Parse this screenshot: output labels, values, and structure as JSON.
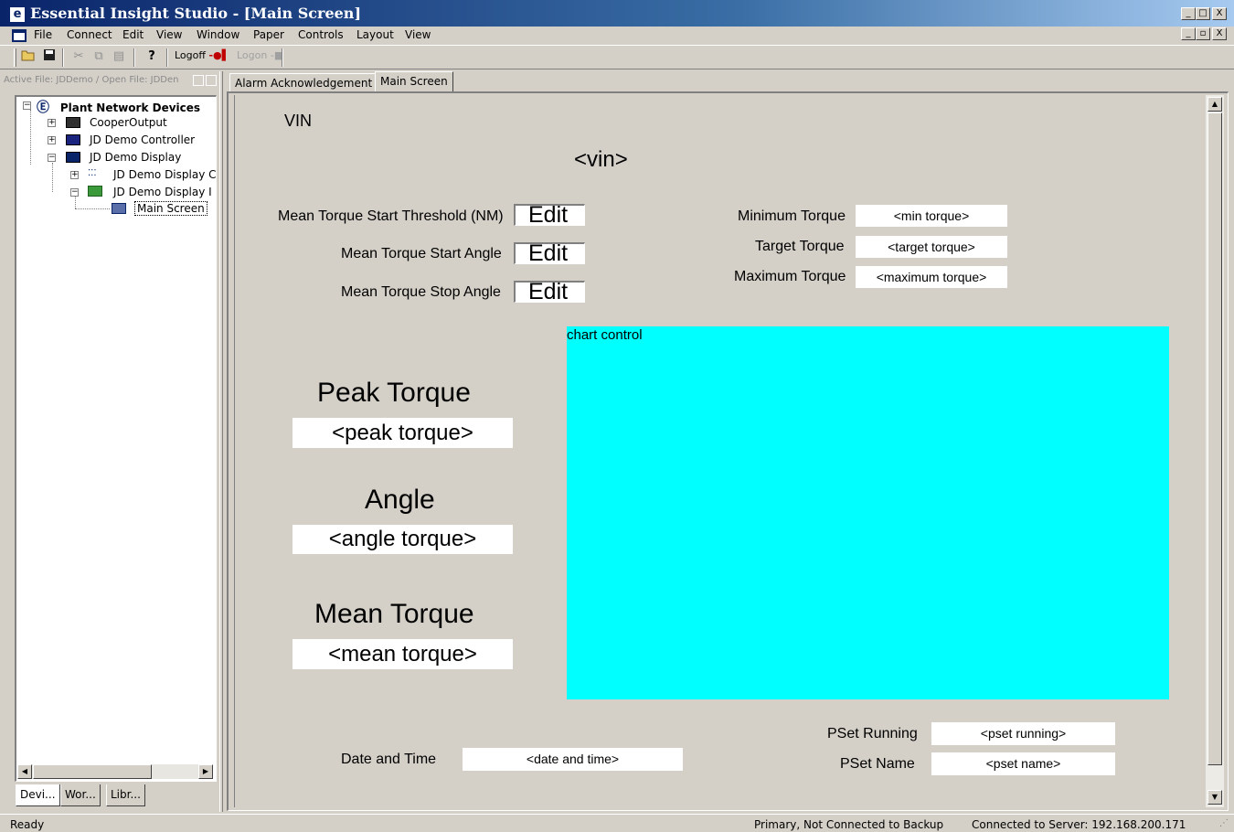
{
  "window": {
    "title": "Essential Insight Studio - [Main Screen]",
    "icon": "app-logo-icon",
    "caption_buttons": [
      "_",
      "□",
      "X"
    ],
    "mdi_buttons": [
      "_",
      "▫",
      "X"
    ]
  },
  "menu": {
    "items": [
      "File",
      "Connect",
      "Edit",
      "View",
      "Window",
      "Paper",
      "Controls",
      "Layout",
      "View"
    ]
  },
  "toolbar": {
    "logoff_label": "Logoff",
    "logon_label": "Logon"
  },
  "left_panel": {
    "active_file": "Active File: JDDemo / Open File: JDDen",
    "tree": {
      "root": "Plant Network Devices",
      "items": [
        {
          "label": "CooperOutput"
        },
        {
          "label": "JD Demo Controller"
        },
        {
          "label": "JD Demo Display"
        },
        {
          "label": "JD Demo Display C"
        },
        {
          "label": "JD Demo Display I"
        },
        {
          "label": "Main Screen"
        }
      ]
    },
    "bottom_tabs": [
      "Devi...",
      "Wor...",
      "Libr..."
    ]
  },
  "doc_tabs": [
    "Alarm Acknowledgement",
    "Main Screen"
  ],
  "screen": {
    "vin_label": "VIN",
    "vin_value": "<vin>",
    "mean_torque_start_threshold_label": "Mean Torque Start Threshold (NM)",
    "mean_torque_start_angle_label": "Mean Torque Start Angle",
    "mean_torque_stop_angle_label": "Mean Torque Stop Angle",
    "edit_value": "Edit",
    "minimum_torque_label": "Minimum Torque",
    "minimum_torque_value": "<min torque>",
    "target_torque_label": "Target Torque",
    "target_torque_value": "<target torque>",
    "maximum_torque_label": "Maximum Torque",
    "maximum_torque_value": "<maximum torque>",
    "peak_torque_label": "Peak Torque",
    "peak_torque_value": "<peak torque>",
    "angle_label": "Angle",
    "angle_value": "<angle torque>",
    "mean_torque_label": "Mean Torque",
    "mean_torque_value": "<mean torque>",
    "chart_control_label": "chart control",
    "chart_control_color": "#00ffff",
    "pset_running_label": "PSet Running",
    "pset_running_value": "<pset running>",
    "pset_name_label": "PSet Name",
    "pset_name_value": "<pset name>",
    "date_time_label": "Date and Time",
    "date_time_value": "<date and time>"
  },
  "status": {
    "left": "Ready",
    "backup": "Primary, Not Connected to Backup",
    "server": "Connected to Server: 192.168.200.171"
  }
}
